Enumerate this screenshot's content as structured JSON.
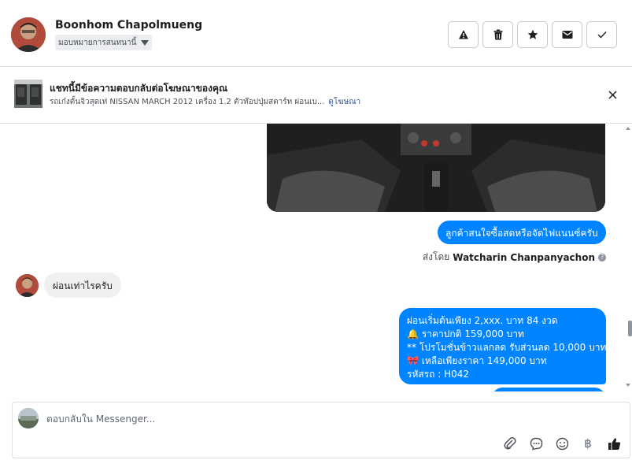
{
  "header": {
    "contact_name": "Boonhom Chapolmueng",
    "assign_label": "มอบหมายการสนทนานี้",
    "actions": [
      {
        "name": "warning-icon",
        "label": "Report"
      },
      {
        "name": "trash-icon",
        "label": "Delete"
      },
      {
        "name": "star-icon",
        "label": "Star"
      },
      {
        "name": "envelope-icon",
        "label": "Mark unread"
      },
      {
        "name": "check-icon",
        "label": "Done"
      }
    ]
  },
  "ad_banner": {
    "title": "แชทนี้มีข้อความตอบกลับต่อโฆษณาของคุณ",
    "subtitle": "รถเก๋งตั้นจิวสุดเท่ NISSAN MARCH 2012 เครื่อง 1.2 ตัวท๊อปปุ่มสตาร์ท ผ่อนเบ...",
    "link": "ดูโฆษณา"
  },
  "messages": {
    "out1": "ลูกค้าสนใจซื้อสดหรือจัดไฟแนนซ์ครับ",
    "sent_by_prefix": "ส่งโดย",
    "sent_by_name": "Watcharin Chanpanyachon",
    "in1": "ผ่อนเท่าไรครับ",
    "out2": [
      "ผ่อนเริ่มต้นเพียง 2,xxx. บาท 84 งวด",
      "🔔 ราคาปกติ  159,000 บาท",
      "** โปรโมชั่นข้าวแลกลด รับส่วนลด 10,000 บาท",
      "🎀  เหลือเพียงราคา 149,000 บาท",
      " รหัสรถ : H042"
    ]
  },
  "composer": {
    "placeholder": "ตอบกลับใน Messenger...",
    "tools": [
      "paperclip-icon",
      "chat-bubble-icon",
      "smiley-icon",
      "baht-icon",
      "thumbs-up-icon"
    ],
    "baht_symbol": "฿"
  },
  "colors": {
    "outgoing_bubble": "#0084ff",
    "incoming_bubble": "#f1f0f0",
    "link": "#385898"
  }
}
